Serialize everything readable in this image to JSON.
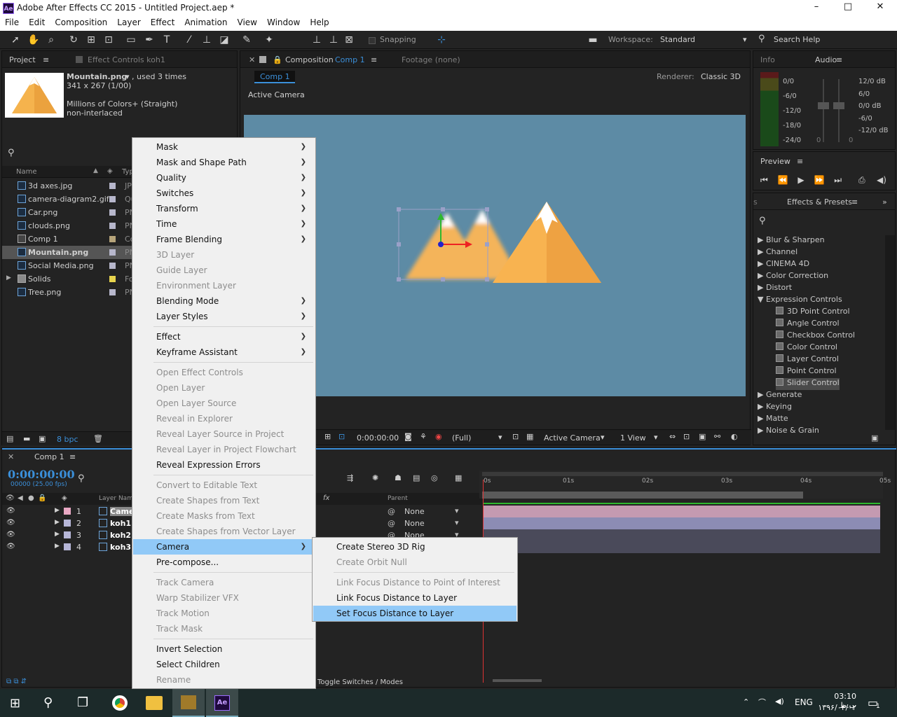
{
  "app": {
    "title": "Adobe After Effects CC 2015 - Untitled Project.aep *",
    "logo": "Ae"
  },
  "window_controls": {
    "min": "–",
    "max": "□",
    "close": "✕"
  },
  "menu": [
    "File",
    "Edit",
    "Composition",
    "Layer",
    "Effect",
    "Animation",
    "View",
    "Window",
    "Help"
  ],
  "toolbar": {
    "snapping": "Snapping",
    "workspace_label": "Workspace:",
    "workspace": "Standard",
    "search": "Search Help"
  },
  "project": {
    "tab": "Project",
    "tab2": "Effect Controls koh1",
    "asset_name": "Mountain.png",
    "asset_used": ", used 3 times",
    "asset_dims": "341 x 267 (1/00)",
    "asset_colors": "Millions of Colors+ (Straight)",
    "asset_interlace": "non-interlaced",
    "col_name": "Name",
    "col_type": "Typ",
    "items": [
      {
        "name": "3d axes.jpg",
        "type": "JP"
      },
      {
        "name": "camera-diagram2.gif",
        "type": "Qu"
      },
      {
        "name": "Car.png",
        "type": "PN"
      },
      {
        "name": "clouds.png",
        "type": "PN"
      },
      {
        "name": "Comp 1",
        "type": "Co"
      },
      {
        "name": "Mountain.png",
        "type": "PN"
      },
      {
        "name": "Social Media.png",
        "type": "PN"
      },
      {
        "name": "Solids",
        "type": "Fo"
      },
      {
        "name": "Tree.png",
        "type": "PN"
      }
    ],
    "bpc": "8 bpc"
  },
  "comp": {
    "tab": "Composition",
    "tab_comp": "Comp 1",
    "tab_footage": "Footage (none)",
    "subtab": "Comp 1",
    "renderer_label": "Renderer:",
    "renderer": "Classic 3D",
    "view_label": "Active Camera",
    "timecode": "0:00:00:00",
    "resolution": "(Full)",
    "camera": "Active Camera",
    "views": "1 View"
  },
  "info": {
    "tab": "Info",
    "audio_tab": "Audio",
    "db_left": [
      "0/0",
      "-6/0",
      "-12/0",
      "-18/0",
      "-24/0"
    ],
    "db_right": [
      "12/0 dB",
      "6/0",
      "0/0 dB",
      "-6/0",
      "-12/0 dB"
    ],
    "zero": "0"
  },
  "preview": {
    "tab": "Preview"
  },
  "effects": {
    "tab": "Effects & Presets",
    "cats": [
      "Blur & Sharpen",
      "Channel",
      "CINEMA 4D",
      "Color Correction",
      "Distort",
      "Expression Controls"
    ],
    "children": [
      "3D Point Control",
      "Angle Control",
      "Checkbox Control",
      "Color Control",
      "Layer Control",
      "Point Control",
      "Slider Control"
    ],
    "cats2": [
      "Generate",
      "Keying",
      "Matte",
      "Noise & Grain"
    ]
  },
  "timeline": {
    "tab": "Comp 1",
    "timecode": "0:00:00:00",
    "fps": "00000 (25.00 fps)",
    "col_layer": "Layer Name",
    "col_parent": "Parent",
    "layers": [
      {
        "num": "1",
        "name": "Came"
      },
      {
        "num": "2",
        "name": "koh1"
      },
      {
        "num": "3",
        "name": "koh2"
      },
      {
        "num": "4",
        "name": "koh3"
      }
    ],
    "parent_vals": [
      "None",
      "None",
      "None"
    ],
    "ticks": [
      "0s",
      "01s",
      "02s",
      "03s",
      "04s",
      "05s"
    ],
    "switches": "Toggle Switches / Modes"
  },
  "context_menu": {
    "items": [
      {
        "label": "Mask",
        "sub": true
      },
      {
        "label": "Mask and Shape Path",
        "sub": true
      },
      {
        "label": "Quality",
        "sub": true
      },
      {
        "label": "Switches",
        "sub": true
      },
      {
        "label": "Transform",
        "sub": true
      },
      {
        "label": "Time",
        "sub": true
      },
      {
        "label": "Frame Blending",
        "sub": true
      },
      {
        "label": "3D Layer",
        "dis": true
      },
      {
        "label": "Guide Layer",
        "dis": true
      },
      {
        "label": "Environment Layer",
        "dis": true
      },
      {
        "label": "Blending Mode",
        "sub": true
      },
      {
        "label": "Layer Styles",
        "sub": true
      },
      {
        "sep": true
      },
      {
        "label": "Effect",
        "sub": true
      },
      {
        "label": "Keyframe Assistant",
        "sub": true
      },
      {
        "sep": true
      },
      {
        "label": "Open Effect Controls",
        "dis": true
      },
      {
        "label": "Open Layer",
        "dis": true
      },
      {
        "label": "Open Layer Source",
        "dis": true
      },
      {
        "label": "Reveal in Explorer",
        "dis": true
      },
      {
        "label": "Reveal Layer Source in Project",
        "dis": true
      },
      {
        "label": "Reveal Layer in Project Flowchart",
        "dis": true
      },
      {
        "label": "Reveal Expression Errors"
      },
      {
        "sep": true
      },
      {
        "label": "Convert to Editable Text",
        "dis": true
      },
      {
        "label": "Create Shapes from Text",
        "dis": true
      },
      {
        "label": "Create Masks from Text",
        "dis": true
      },
      {
        "label": "Create Shapes from Vector Layer",
        "dis": true
      },
      {
        "label": "Camera",
        "sub": true,
        "hl": true
      },
      {
        "label": "Pre-compose..."
      },
      {
        "sep": true
      },
      {
        "label": "Track Camera",
        "dis": true
      },
      {
        "label": "Warp Stabilizer VFX",
        "dis": true
      },
      {
        "label": "Track Motion",
        "dis": true
      },
      {
        "label": "Track Mask",
        "dis": true
      },
      {
        "sep": true
      },
      {
        "label": "Invert Selection"
      },
      {
        "label": "Select Children"
      },
      {
        "label": "Rename",
        "dis": true
      }
    ]
  },
  "camera_submenu": {
    "items": [
      {
        "label": "Create Stereo 3D Rig"
      },
      {
        "label": "Create Orbit Null",
        "dis": true
      },
      {
        "sep": true
      },
      {
        "label": "Link Focus Distance to Point of Interest",
        "dis": true
      },
      {
        "label": "Link Focus Distance to Layer"
      },
      {
        "label": "Set Focus Distance to Layer",
        "hl": true
      }
    ]
  },
  "taskbar": {
    "lang": "ENG",
    "time": "03:10 ب.ظ",
    "date": "۱۳۹۶/۰۴/۰۲",
    "notif": "1"
  }
}
